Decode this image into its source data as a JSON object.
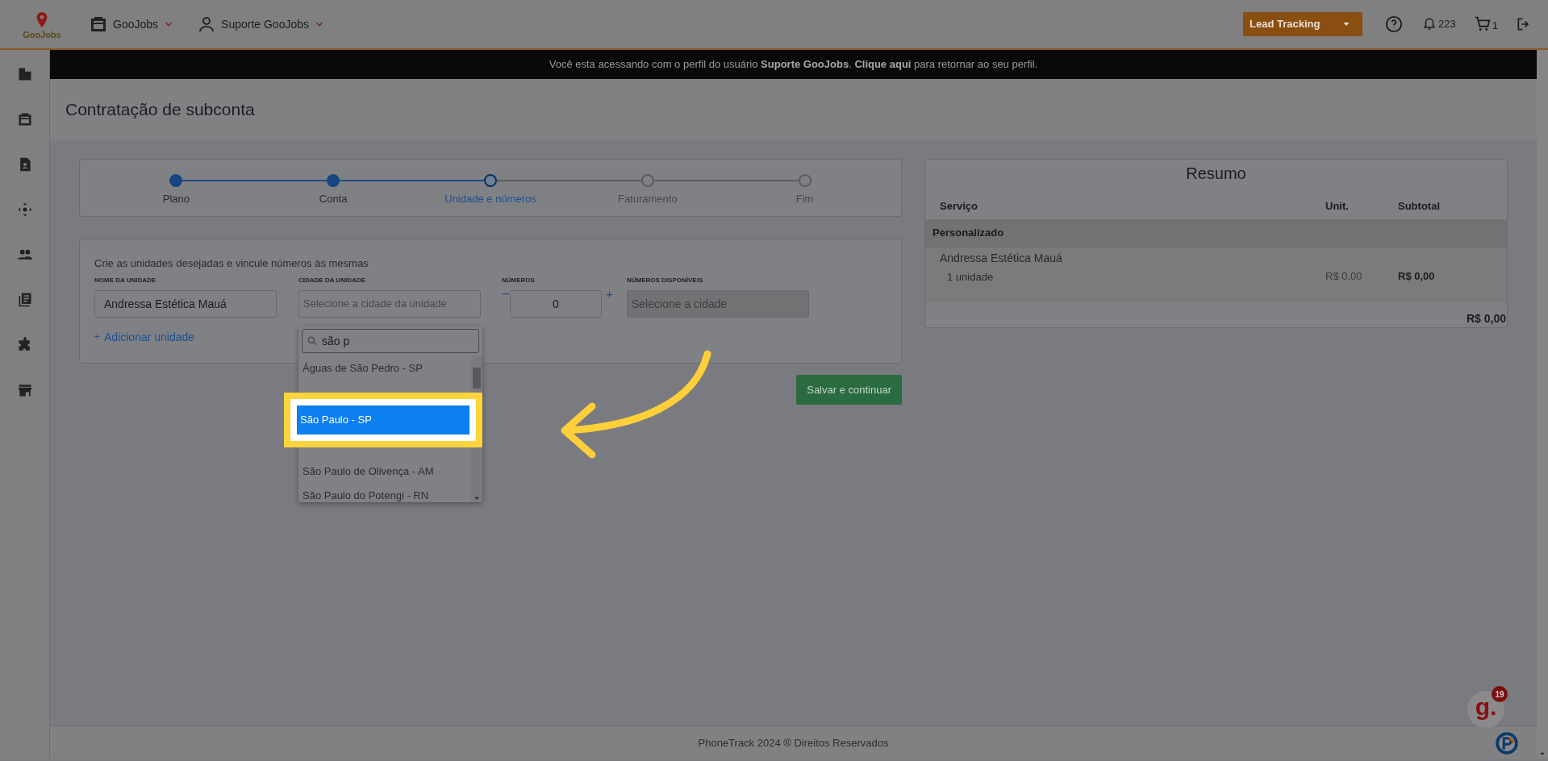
{
  "header": {
    "logo_text": "GooJobs",
    "menus": [
      {
        "label": "GooJobs"
      },
      {
        "label": "Suporte GooJobs"
      }
    ],
    "lead_button": "Lead Tracking",
    "notifications": "223",
    "cart": "1"
  },
  "banner": {
    "before": "Você esta acessando com o perfil do usuário **Suporte GooJobs**.",
    "link": "Clique aqui",
    "after": "para retornar ao seu perfil."
  },
  "page_title": "Contratação de subconta",
  "stepper": [
    {
      "label": "Plano",
      "done": true,
      "selected": false
    },
    {
      "label": "Conta",
      "done": true,
      "selected": false
    },
    {
      "label": "Unidade e números",
      "done": false,
      "selected": true
    },
    {
      "label": "Faturamento",
      "done": false,
      "selected": false
    },
    {
      "label": "Fim",
      "done": false,
      "selected": false
    }
  ],
  "form": {
    "intro": "Crie as unidades desejadas e vincule números às mesmas",
    "unit_label": "NOME DA UNIDADE",
    "unit_value": "Andressa Estética Mauá",
    "city_label": "CIDADE DA UNIDADE",
    "city_placeholder": "Selecione a cidade da unidade",
    "numbers_label": "NÚMEROS",
    "numbers_value": "0",
    "minus": "−",
    "plus": "+",
    "available_label": "NÚMEROS DISPONÍVEIS",
    "available_placeholder": "Selecione a cidade",
    "add_unit": "Adicionar unidade",
    "add_icon": "+",
    "save_button": "Salvar e continuar"
  },
  "city_dropdown": {
    "search": "são p",
    "options": [
      {
        "label": "Águas de São Pedro - SP",
        "selected": false
      },
      {
        "label": "São Paulo - SP",
        "selected": true
      },
      {
        "label": "São Paulo de Olivença - AM",
        "selected": false
      },
      {
        "label": "São Paulo do Potengi - RN",
        "selected": false
      }
    ]
  },
  "summary": {
    "title": "Resumo",
    "columns": [
      "Serviço",
      "Unit.",
      "Subtotal"
    ],
    "group": "Personalizado",
    "item": {
      "name": "Andressa Estética Mauá",
      "quantity": "1 unidade",
      "unit": "R$ 0,00",
      "subtotal": "R$ 0,00"
    },
    "total": "R$ 0,00"
  },
  "footer": "PhoneTrack 2024 ® Direitos Reservados",
  "chat_badge": {
    "letter": "g.",
    "count": "19"
  }
}
